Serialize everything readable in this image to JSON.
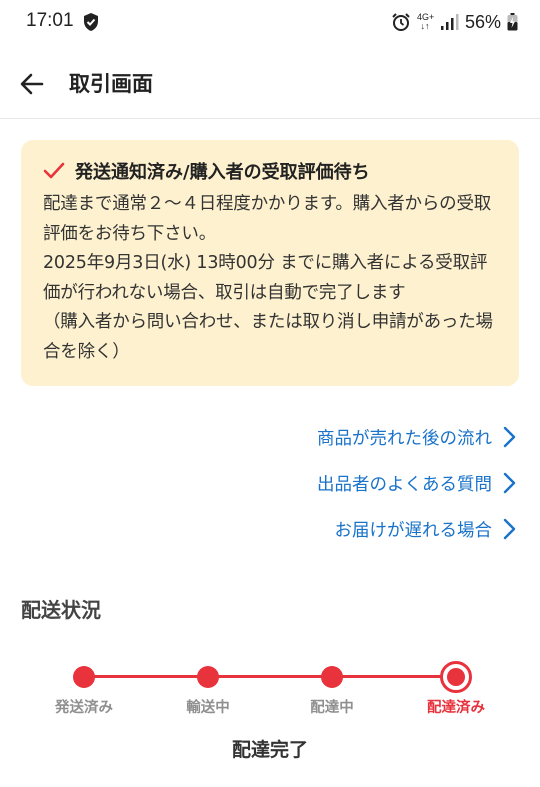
{
  "status_bar": {
    "time": "17:01",
    "network_top": "4G+",
    "network_bottom": "↓↑",
    "battery_percent": "56%"
  },
  "header": {
    "title": "取引画面"
  },
  "notice": {
    "title": "発送通知済み/購入者の受取評価待ち",
    "body": "配達まで通常２～４日程度かかります。購入者からの受取評価をお待ち下さい。\n 2025年9月3日(水) 13時00分 までに購入者による受取評価が行われない場合、取引は自動で完了します\n（購入者から問い合わせ、または取り消し申請があった場合を除く）",
    "accent_color": "#e8323c",
    "background_color": "#fdf1cf"
  },
  "links": [
    {
      "label": "商品が売れた後の流れ"
    },
    {
      "label": "出品者のよくある質問"
    },
    {
      "label": "お届けが遅れる場合"
    }
  ],
  "shipping": {
    "section_title": "配送状況",
    "steps": [
      {
        "label": "発送済み"
      },
      {
        "label": "輸送中"
      },
      {
        "label": "配達中"
      },
      {
        "label": "配達済み"
      }
    ],
    "current_step_index": 3,
    "status_text": "配達完了"
  }
}
